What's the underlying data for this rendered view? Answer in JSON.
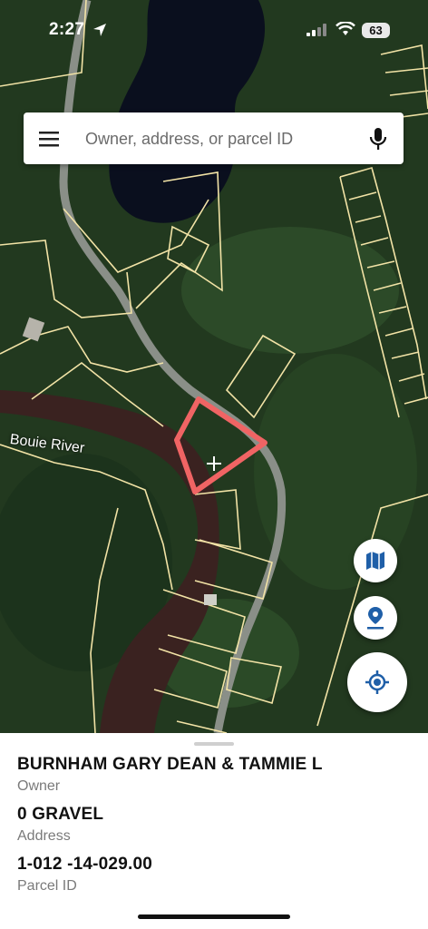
{
  "status_bar": {
    "time": "2:27",
    "battery": "63"
  },
  "search": {
    "placeholder": "Owner, address, or parcel ID"
  },
  "map": {
    "river_label": "Bouie River",
    "selected_parcel_color": "#f06464",
    "parcel_line_color": "#f2e3a6"
  },
  "parcel": {
    "owner": "BURNHAM GARY DEAN & TAMMIE L",
    "owner_label": "Owner",
    "address": "0 GRAVEL",
    "address_label": "Address",
    "parcel_id": "1-012 -14-029.00",
    "parcel_id_label": "Parcel ID"
  },
  "colors": {
    "accent": "#1f5fa8",
    "water": "#3a2220",
    "forest": "#1f3a22"
  }
}
